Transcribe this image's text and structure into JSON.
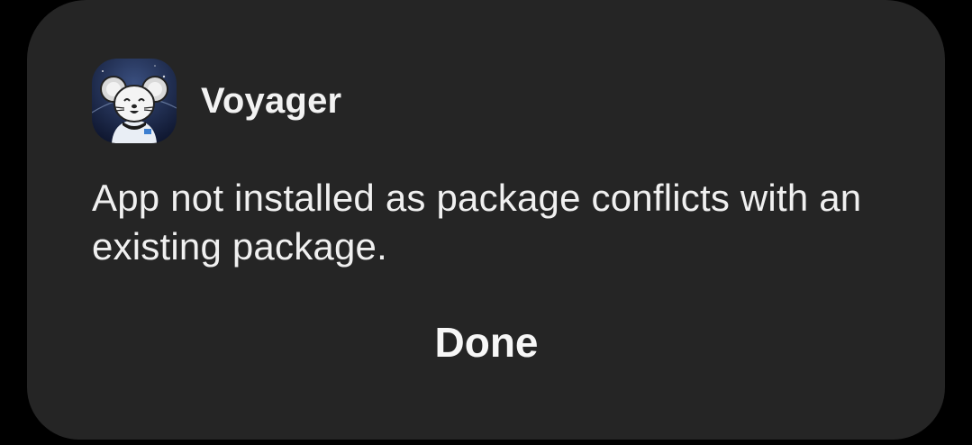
{
  "dialog": {
    "app_name": "Voyager",
    "app_icon": "voyager-mouse-astronaut-icon",
    "message": "App not installed as package conflicts with an existing package.",
    "done_label": "Done"
  },
  "colors": {
    "screen_background": "#000000",
    "dialog_background": "#252525",
    "text": "#f0f0f0",
    "icon_background": "#1e2b4a"
  }
}
